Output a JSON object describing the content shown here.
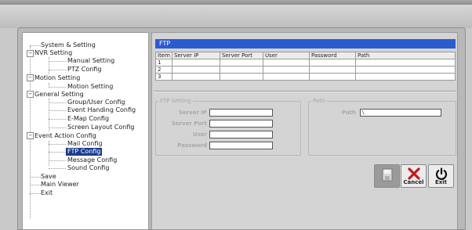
{
  "tree": {
    "items": [
      {
        "label": "System & Setting"
      },
      {
        "label": "NVR Setting"
      },
      {
        "label": "Manual Setting"
      },
      {
        "label": "PTZ Config"
      },
      {
        "label": "Motion Setting"
      },
      {
        "label": "Motion Setting"
      },
      {
        "label": "General Setting"
      },
      {
        "label": "Group/User Config"
      },
      {
        "label": "Event Handing Config"
      },
      {
        "label": "E-Map Config"
      },
      {
        "label": "Screen Layout Config"
      },
      {
        "label": "Event Action Config"
      },
      {
        "label": "Mail Config"
      },
      {
        "label": "FTP Config"
      },
      {
        "label": "Message Config"
      },
      {
        "label": "Sound Config"
      },
      {
        "label": "Save"
      },
      {
        "label": "Main Viewer"
      },
      {
        "label": "Exit"
      }
    ],
    "toggle_minus": "−"
  },
  "panel": {
    "title": "FTP",
    "table": {
      "headers": [
        "Item",
        "Server IP",
        "Server Port",
        "User",
        "Password",
        "Path"
      ],
      "rows": [
        [
          "1",
          "",
          "",
          "",
          "",
          ""
        ],
        [
          "2",
          "",
          "",
          "",
          "",
          ""
        ],
        [
          "3",
          "",
          "",
          "",
          "",
          ""
        ]
      ]
    },
    "ftp_setting": {
      "group_label": "FTP Setting",
      "server_ip_label": "Server IP",
      "server_port_label": "Server Port",
      "user_label": "User",
      "password_label": "Password"
    },
    "path_group": {
      "group_label": "Path",
      "path_label": "Path",
      "path_value": "\\"
    }
  },
  "buttons": {
    "save_icon": "save-disk-icon",
    "cancel_label": "Cancel",
    "exit_label": "Exit"
  },
  "colors": {
    "title_bar": "#2a5bd0",
    "selected": "#1e3c8c",
    "cancel_x": "#c41a1a"
  }
}
